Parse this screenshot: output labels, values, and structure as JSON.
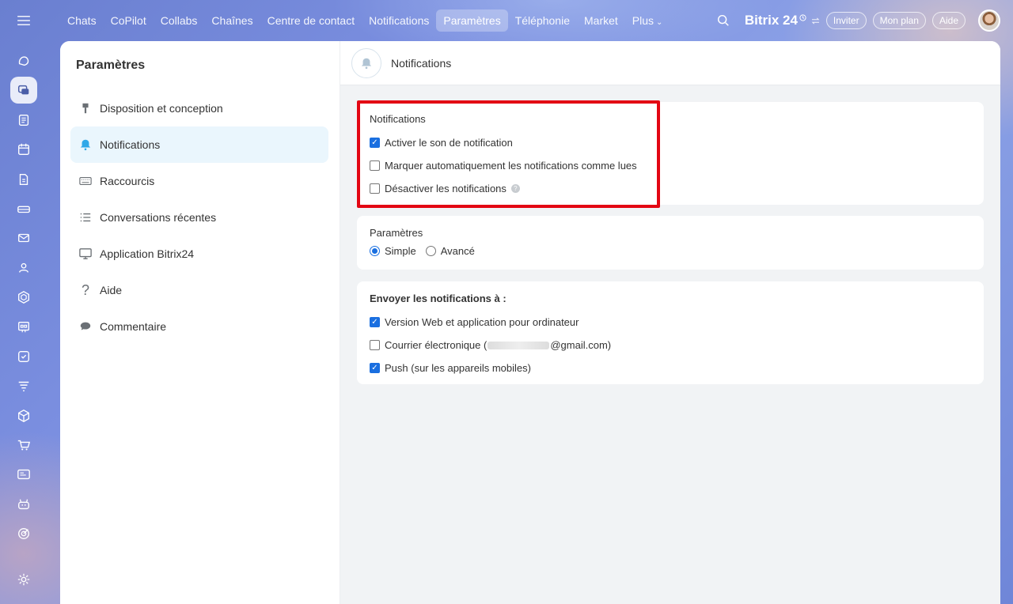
{
  "topnav": {
    "items": [
      {
        "label": "Chats",
        "active": false
      },
      {
        "label": "CoPilot",
        "active": false
      },
      {
        "label": "Collabs",
        "active": false
      },
      {
        "label": "Chaînes",
        "active": false
      },
      {
        "label": "Centre de contact",
        "active": false
      },
      {
        "label": "Notifications",
        "active": false
      },
      {
        "label": "Paramètres",
        "active": true
      },
      {
        "label": "Téléphonie",
        "active": false
      },
      {
        "label": "Market",
        "active": false
      },
      {
        "label": "Plus",
        "active": false
      }
    ],
    "more_chevron": "⌄"
  },
  "topright": {
    "brand": "Bitrix 24",
    "invite": "Inviter",
    "plan": "Mon plan",
    "help": "Aide"
  },
  "sidebar": {
    "title": "Paramètres",
    "items": [
      {
        "label": "Disposition et conception",
        "icon": "brush-icon"
      },
      {
        "label": "Notifications",
        "icon": "bell-icon"
      },
      {
        "label": "Raccourcis",
        "icon": "keyboard-icon"
      },
      {
        "label": "Conversations récentes",
        "icon": "list-icon"
      },
      {
        "label": "Application Bitrix24",
        "icon": "monitor-icon"
      },
      {
        "label": "Aide",
        "icon": "question-icon"
      },
      {
        "label": "Commentaire",
        "icon": "comment-icon"
      }
    ]
  },
  "content": {
    "header_title": "Notifications",
    "notifications_card": {
      "title": "Notifications",
      "options": [
        {
          "label": "Activer le son de notification",
          "checked": true
        },
        {
          "label": "Marquer automatiquement les notifications comme lues",
          "checked": false
        },
        {
          "label": "Désactiver les notifications",
          "checked": false
        }
      ]
    },
    "params_card": {
      "title": "Paramètres",
      "simple": "Simple",
      "advanced": "Avancé",
      "selected": "Simple"
    },
    "send_card": {
      "title": "Envoyer les notifications à :",
      "web": "Version Web et application pour ordinateur",
      "email_prefix": "Courrier électronique (",
      "email_suffix": "@gmail.com)",
      "push": "Push (sur les appareils mobiles)"
    }
  },
  "colors": {
    "accent": "#1a6fe0",
    "highlight": "#e30613",
    "active_side_bg": "#eaf6fd"
  }
}
